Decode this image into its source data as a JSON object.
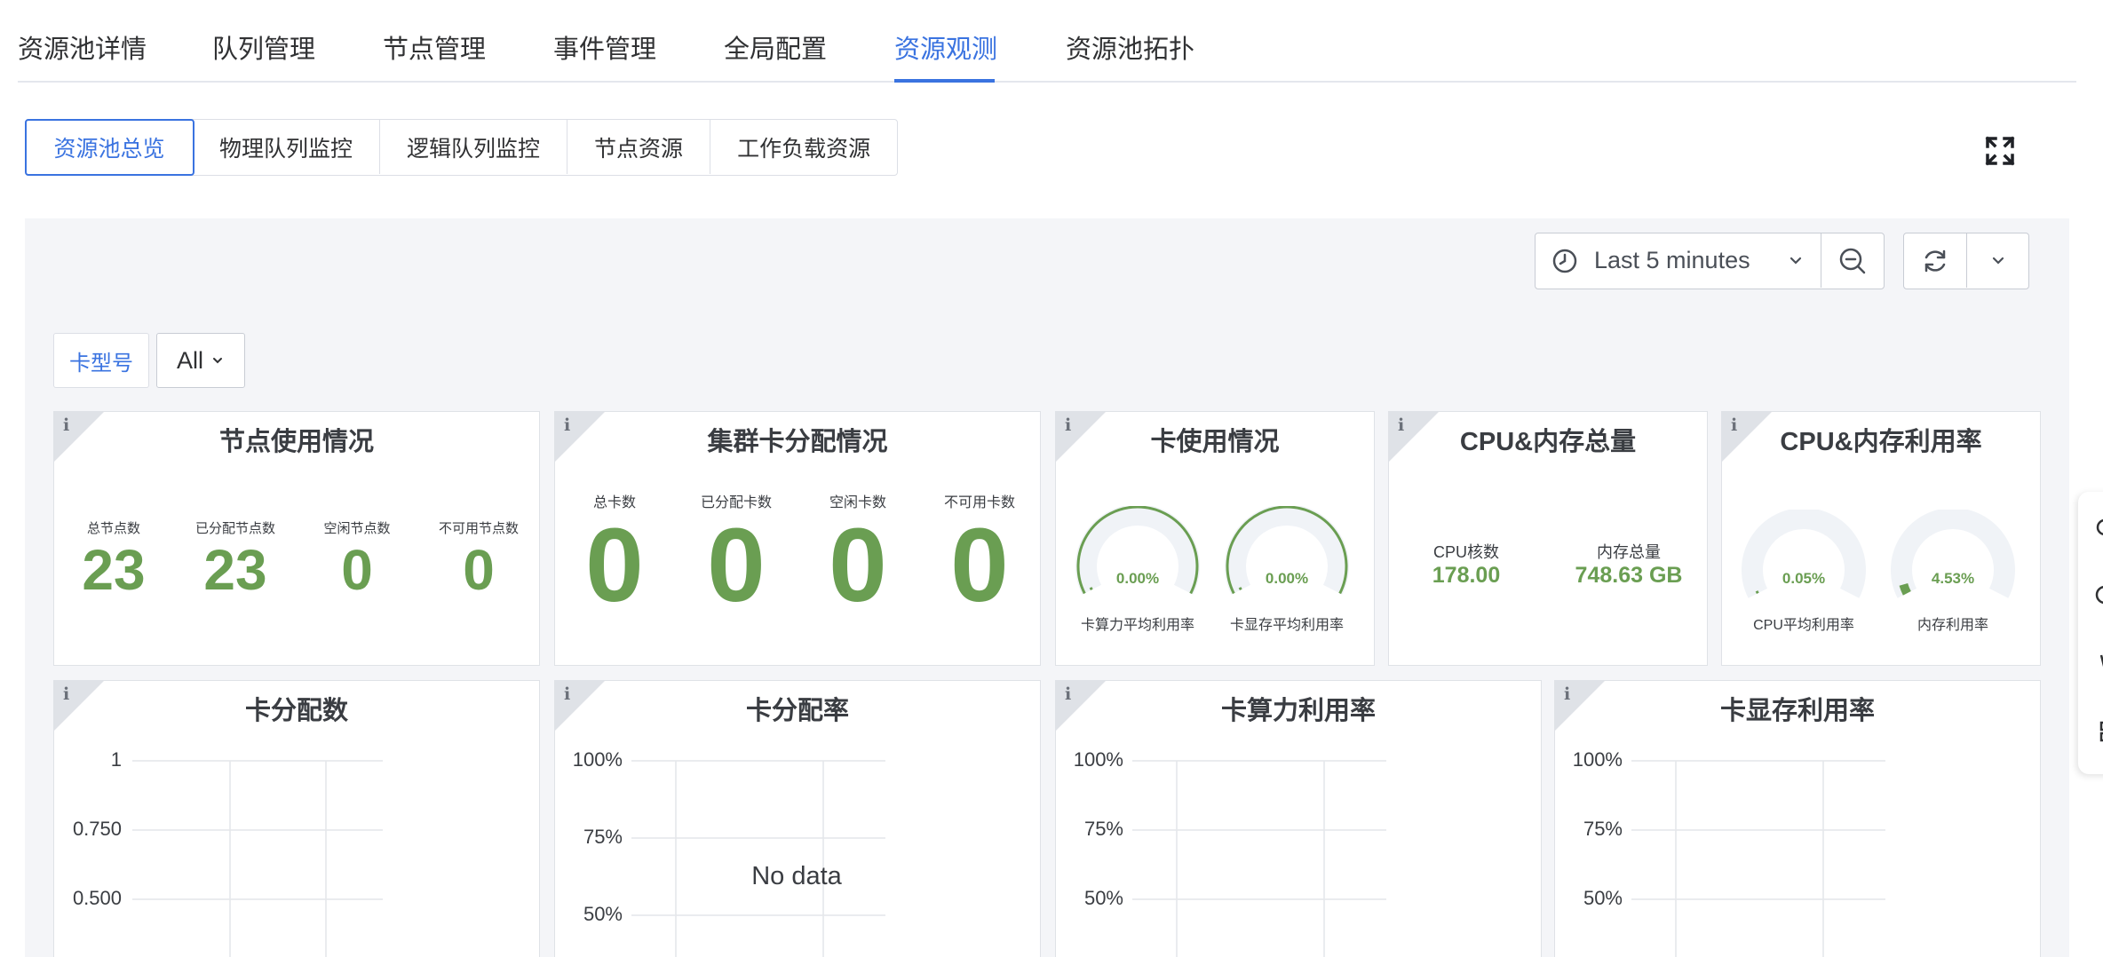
{
  "top_tabs": [
    "资源池详情",
    "队列管理",
    "节点管理",
    "事件管理",
    "全局配置",
    "资源观测",
    "资源池拓扑"
  ],
  "top_tab_active": "资源观测",
  "sub_tabs": [
    "资源池总览",
    "物理队列监控",
    "逻辑队列监控",
    "节点资源",
    "工作负载资源"
  ],
  "sub_tab_active": "资源池总览",
  "time_picker": {
    "label": "Last 5 minutes"
  },
  "variable": {
    "label": "卡型号",
    "value": "All"
  },
  "panels": {
    "node_usage": {
      "title": "节点使用情况",
      "stats": [
        {
          "label": "总节点数",
          "value": "23"
        },
        {
          "label": "已分配节点数",
          "value": "23"
        },
        {
          "label": "空闲节点数",
          "value": "0"
        },
        {
          "label": "不可用节点数",
          "value": "0"
        }
      ]
    },
    "card_alloc": {
      "title": "集群卡分配情况",
      "stats": [
        {
          "label": "总卡数",
          "value": "0"
        },
        {
          "label": "已分配卡数",
          "value": "0"
        },
        {
          "label": "空闲卡数",
          "value": "0"
        },
        {
          "label": "不可用卡数",
          "value": "0"
        }
      ]
    },
    "card_usage": {
      "title": "卡使用情况",
      "gauges": [
        {
          "label": "卡算力平均利用率",
          "value": "0.00%",
          "fraction": 0.0
        },
        {
          "label": "卡显存平均利用率",
          "value": "0.00%",
          "fraction": 0.0
        }
      ]
    },
    "cpu_mem_total": {
      "title": "CPU&内存总量",
      "stats": [
        {
          "label": "CPU核数",
          "value": "178.00"
        },
        {
          "label": "内存总量",
          "value": "748.63 GB"
        }
      ]
    },
    "cpu_mem_util": {
      "title": "CPU&内存利用率",
      "gauges": [
        {
          "label": "CPU平均利用率",
          "value": "0.05%",
          "fraction": 0.0005
        },
        {
          "label": "内存利用率",
          "value": "4.53%",
          "fraction": 0.0453
        }
      ]
    },
    "card_alloc_count": {
      "title": "卡分配数",
      "y_ticks": [
        "1",
        "0.750",
        "0.500"
      ]
    },
    "card_alloc_rate": {
      "title": "卡分配率",
      "y_ticks": [
        "100%",
        "75%",
        "50%"
      ],
      "empty_text": "No data"
    },
    "card_compute_util": {
      "title": "卡算力利用率",
      "y_ticks": [
        "100%",
        "75%",
        "50%"
      ]
    },
    "card_mem_util": {
      "title": "卡显存利用率",
      "y_ticks": [
        "100%",
        "75%",
        "50%"
      ]
    }
  },
  "colors": {
    "accent": "#3a73e0",
    "stat_green": "#6a9e52",
    "gauge_track": "#f0f3f7",
    "dashboard_bg": "#f4f5f8"
  }
}
